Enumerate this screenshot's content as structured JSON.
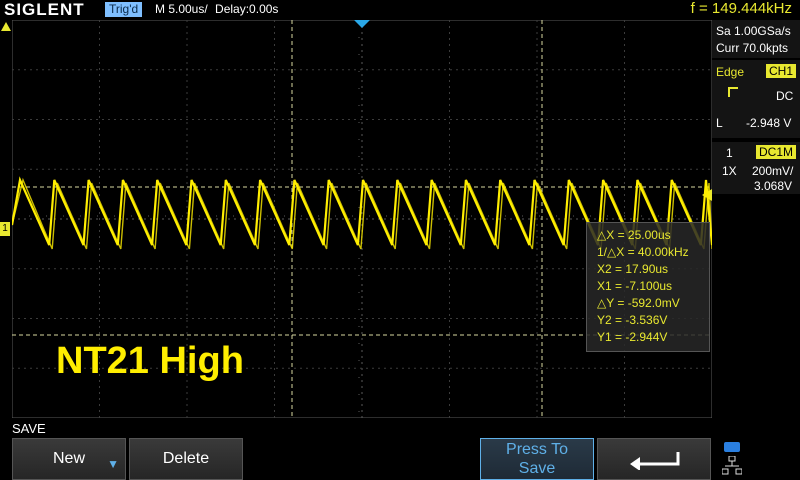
{
  "header": {
    "brand": "SIGLENT",
    "trigger_status": "Trig'd",
    "timebase": "M 5.00us/",
    "delay": "Delay:0.00s",
    "frequency": "f = 149.444kHz"
  },
  "acquisition": {
    "sample_rate": "Sa 1.00GSa/s",
    "memory": "Curr 70.0kpts"
  },
  "trigger": {
    "type": "Edge",
    "source": "CH1",
    "coupling": "DC",
    "level_label": "L",
    "level": "-2.948 V"
  },
  "channel1": {
    "number": "1",
    "coupling": "DC1M",
    "probe": "1X",
    "scale": "200mV/",
    "offset": "3.068V"
  },
  "measurements": {
    "delta_x": "△X = 25.00us",
    "inv_delta_x": "1/△X = 40.00kHz",
    "x2": "X2 = 17.90us",
    "x1": "X1 = -7.100us",
    "delta_y": "△Y = -592.0mV",
    "y2": "Y2 = -3.536V",
    "y1": "Y1 = -2.944V"
  },
  "annotation": "NT21 High",
  "menu": {
    "title": "SAVE",
    "new_label": "New",
    "delete_label": "Delete",
    "press_save_label": "Press To Save"
  },
  "colors": {
    "trace": "#ffee00",
    "accent": "#5fb0e8",
    "grid": "#5a5a5a"
  }
}
